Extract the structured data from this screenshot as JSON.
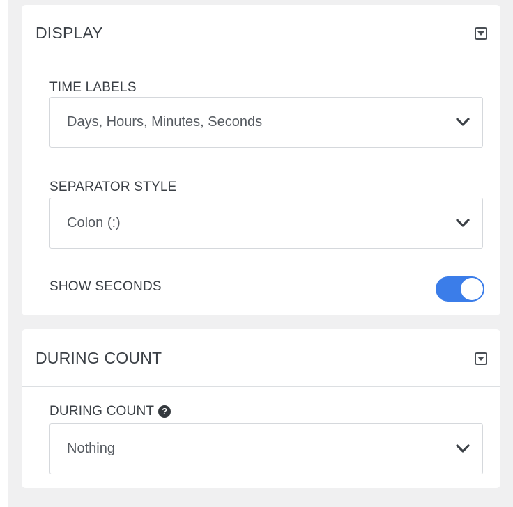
{
  "display_panel": {
    "title": "DISPLAY",
    "time_labels": {
      "label": "TIME LABELS",
      "value": "Days, Hours, Minutes, Seconds"
    },
    "separator_style": {
      "label": "SEPARATOR STYLE",
      "value": "Colon (:)"
    },
    "show_seconds": {
      "label": "SHOW SECONDS",
      "enabled": true
    }
  },
  "during_count_panel": {
    "title": "DURING COUNT",
    "during_count": {
      "label": "DURING COUNT",
      "help_icon": "?",
      "value": "Nothing"
    }
  },
  "colors": {
    "accent": "#3b7de9",
    "background": "#f0f0f1",
    "panel": "#ffffff",
    "text": "#3b4046"
  },
  "icons": {
    "collapse": "collapse-triangle-icon",
    "dropdown": "chevron-down-icon",
    "help": "question-circle-icon"
  }
}
